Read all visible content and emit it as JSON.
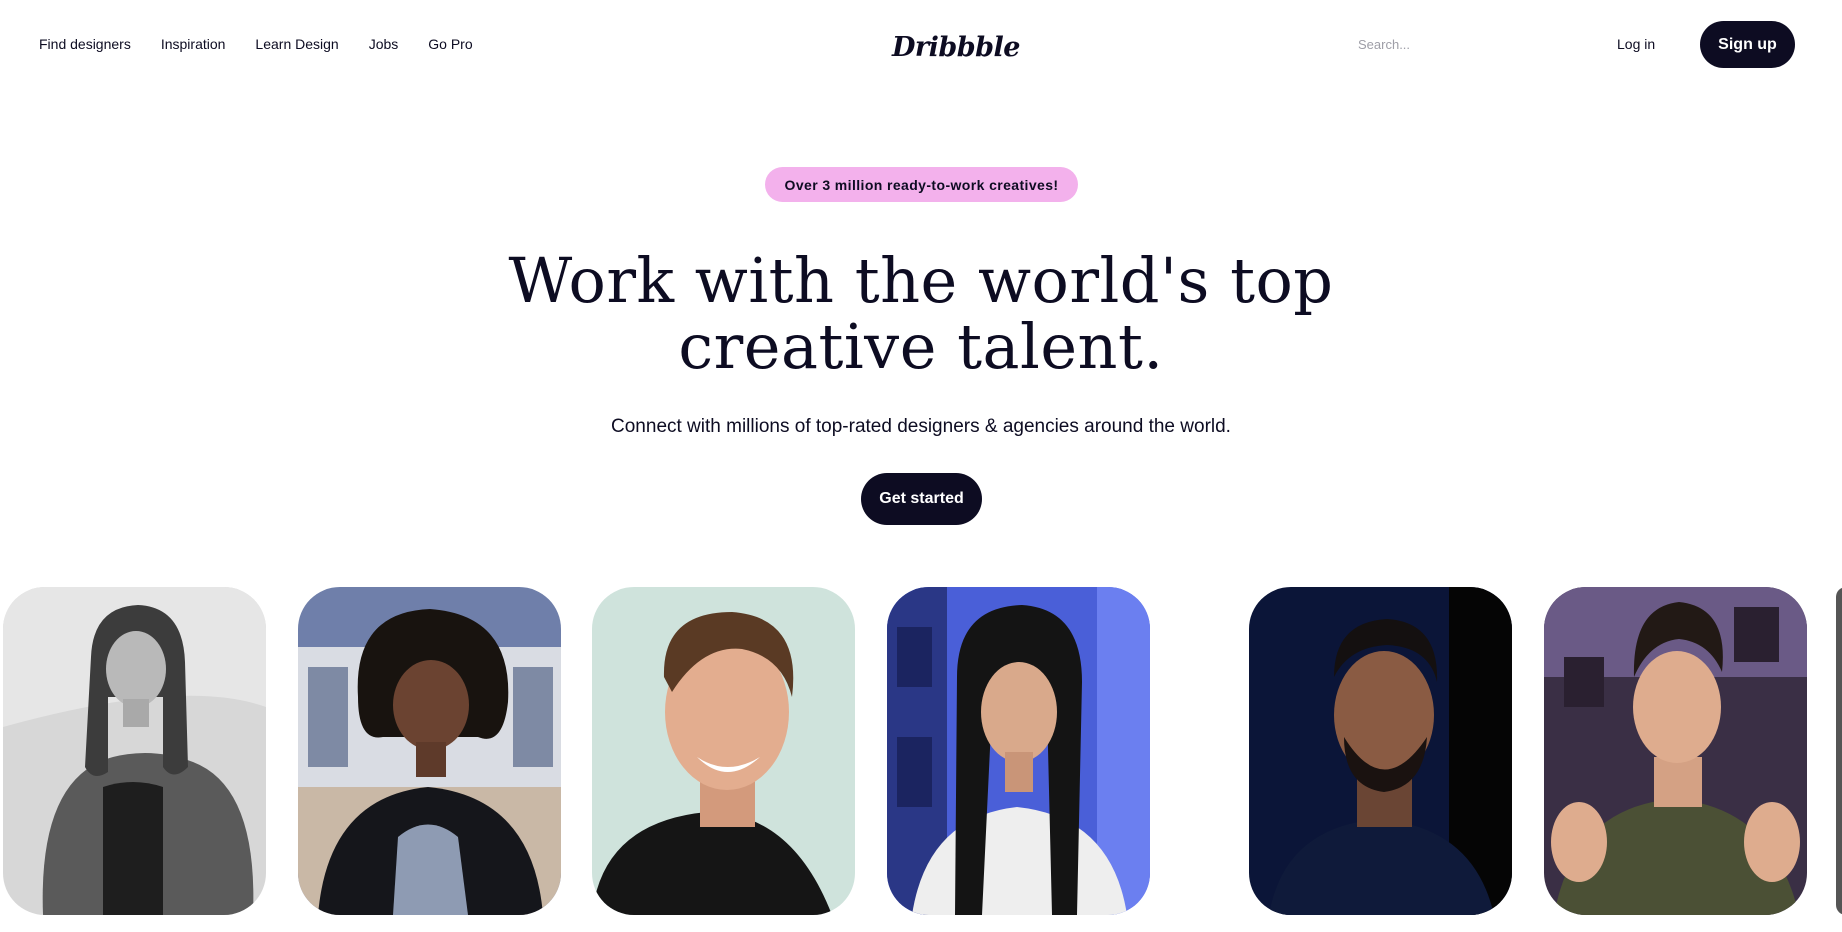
{
  "nav": {
    "links": [
      "Find designers",
      "Inspiration",
      "Learn Design",
      "Jobs",
      "Go Pro"
    ],
    "logo": "Dribbble",
    "search_placeholder": "Search...",
    "login_label": "Log in",
    "signup_label": "Sign up"
  },
  "hero": {
    "badge": "Over 3 million ready-to-work creatives!",
    "headline_line1": "Work with the world's top",
    "headline_line2": "creative talent.",
    "subtext": "Connect with millions of top-rated designers & agencies around the world.",
    "cta_label": "Get started"
  },
  "colors": {
    "ink": "#0d0c22",
    "badge_bg": "#f3b1ec",
    "card_backgrounds": [
      "#d9d9d9",
      "#5f6e9e",
      "#cfe3dc",
      "#4f62d6",
      "#0c1f4f",
      "#3b3046"
    ]
  }
}
